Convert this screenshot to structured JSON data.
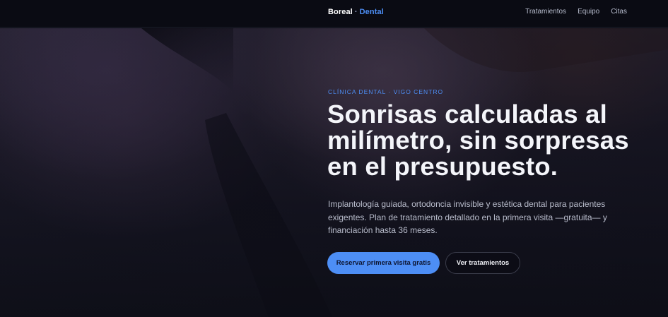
{
  "nav": {
    "brand_primary": "Boreal",
    "brand_separator": "·",
    "brand_secondary": "Dental",
    "links": [
      "Tratamientos",
      "Equipo",
      "Citas"
    ]
  },
  "hero": {
    "eyebrow": "CLÍNICA DENTAL · VIGO CENTRO",
    "headline": "Sonrisas calculadas al milímetro, sin sorpresas en el presupuesto.",
    "description": "Implantología guiada, ortodoncia invisible y estética dental para pacientes exigentes. Plan de tratamiento detallado en la primera visita —gratuita— y financiación hasta 36 meses.",
    "primary_cta": "Reservar primera visita gratis",
    "secondary_cta": "Ver tratamientos"
  },
  "colors": {
    "accent": "#4d8ef5",
    "background": "#0b0c14",
    "text": "#f4f5fa",
    "muted": "#b9bdcc"
  }
}
